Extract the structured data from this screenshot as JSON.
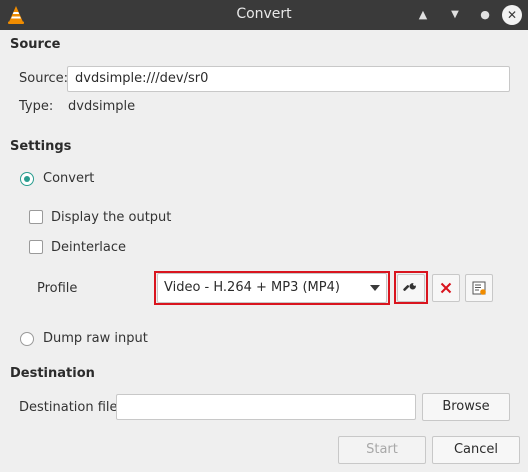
{
  "window": {
    "title": "Convert"
  },
  "source": {
    "heading": "Source",
    "source_label": "Source:",
    "source_value": "dvdsimple:///dev/sr0",
    "type_label": "Type:",
    "type_value": "dvdsimple"
  },
  "settings": {
    "heading": "Settings",
    "convert_label": "Convert",
    "convert_selected": true,
    "display_output_label": "Display the output",
    "display_output_checked": false,
    "deinterlace_label": "Deinterlace",
    "deinterlace_checked": false,
    "profile_label": "Profile",
    "profile_value": "Video - H.264 + MP3 (MP4)",
    "dump_raw_label": "Dump raw input",
    "dump_raw_selected": false
  },
  "destination": {
    "heading": "Destination",
    "file_label": "Destination file:",
    "file_value": "",
    "browse_label": "Browse"
  },
  "actions": {
    "start_label": "Start",
    "cancel_label": "Cancel"
  },
  "colors": {
    "accent": "#2a9d8f",
    "highlight": "#d9141e",
    "delete": "#d9141e",
    "titlebar": "#3a3a3a"
  }
}
